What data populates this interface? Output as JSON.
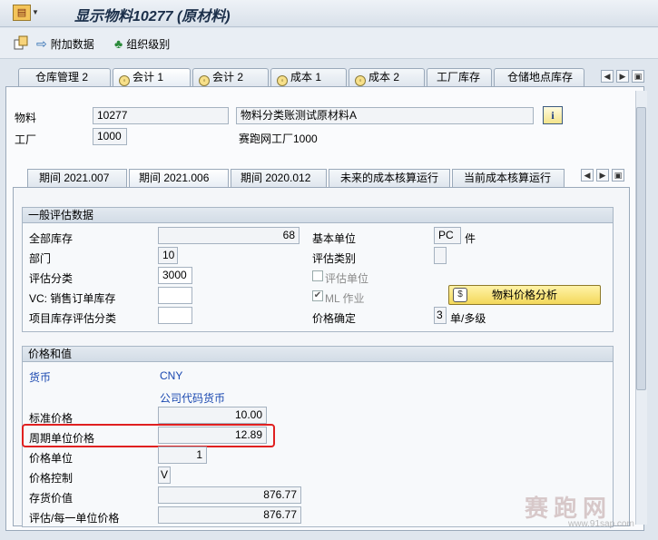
{
  "title": "显示物料10277 (原材料)",
  "toolbar": {
    "additional_data": "附加数据",
    "org_levels": "组织级别"
  },
  "tabs": [
    {
      "label": "仓库管理 2",
      "icon": false
    },
    {
      "label": "会计 1",
      "icon": true
    },
    {
      "label": "会计 2",
      "icon": true
    },
    {
      "label": "成本 1",
      "icon": true
    },
    {
      "label": "成本 2",
      "icon": true
    },
    {
      "label": "工厂库存",
      "icon": false
    },
    {
      "label": "仓储地点库存",
      "icon": false
    }
  ],
  "header": {
    "material_label": "物料",
    "material_value": "10277",
    "material_desc": "物料分类账测试原材料A",
    "plant_label": "工厂",
    "plant_value": "1000",
    "plant_desc": "赛跑网工厂1000"
  },
  "period_tabs": [
    "期间 2021.007",
    "期间 2021.006",
    "期间 2020.012",
    "未来的成本核算运行",
    "当前成本核算运行"
  ],
  "general": {
    "title": "一般评估数据",
    "total_stock_label": "全部库存",
    "total_stock": "68",
    "division_label": "部门",
    "division": "10",
    "valuation_class_label": "评估分类",
    "valuation_class": "3000",
    "vc_sales_label": "VC: 销售订单库存",
    "vc_sales": "",
    "project_stock_label": "项目库存评估分类",
    "project_stock": "",
    "base_unit_label": "基本单位",
    "base_unit": "PC",
    "base_unit_text": "件",
    "valuation_cat_label": "评估类别",
    "valuation_cat": "",
    "valuation_unit_label": "评估单位",
    "ml_act_label": "ML 作业",
    "price_det_label": "价格确定",
    "price_det": "3",
    "price_det_text": "单/多级",
    "analysis_button": "物料价格分析"
  },
  "prices": {
    "title": "价格和值",
    "currency_label": "货币",
    "currency": "CNY",
    "currency_desc": "公司代码货币",
    "std_price_label": "标准价格",
    "std_price": "10.00",
    "periodic_price_label": "周期单位价格",
    "periodic_price": "12.89",
    "price_unit_label": "价格单位",
    "price_unit": "1",
    "price_control_label": "价格控制",
    "price_control": "V",
    "stock_value_label": "存货价值",
    "stock_value": "876.77",
    "val_per_unit_label": "评估/每一单位价格",
    "val_per_unit": "876.77"
  },
  "watermark": {
    "text": "赛跑网",
    "url": "www.91sap.com"
  }
}
